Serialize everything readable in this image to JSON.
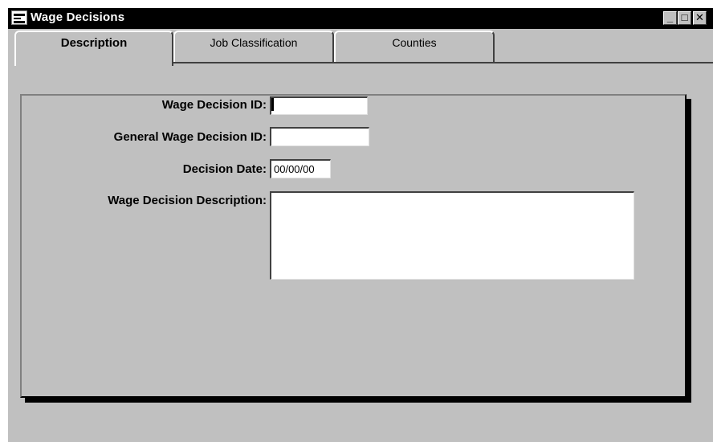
{
  "window": {
    "title": "Wage Decisions",
    "controls": {
      "minimize": "_",
      "maximize": "□",
      "close": "✕"
    }
  },
  "tabs": [
    {
      "label": "Description",
      "active": true
    },
    {
      "label": "Job Classification",
      "active": false
    },
    {
      "label": "Counties",
      "active": false
    }
  ],
  "form": {
    "wage_decision_id": {
      "label": "Wage Decision ID:",
      "value": ""
    },
    "general_wage_decision_id": {
      "label": "General Wage Decision ID:",
      "value": ""
    },
    "decision_date": {
      "label": "Decision Date:",
      "value": "00/00/00"
    },
    "wage_decision_description": {
      "label": "Wage Decision Description:",
      "value": ""
    }
  }
}
